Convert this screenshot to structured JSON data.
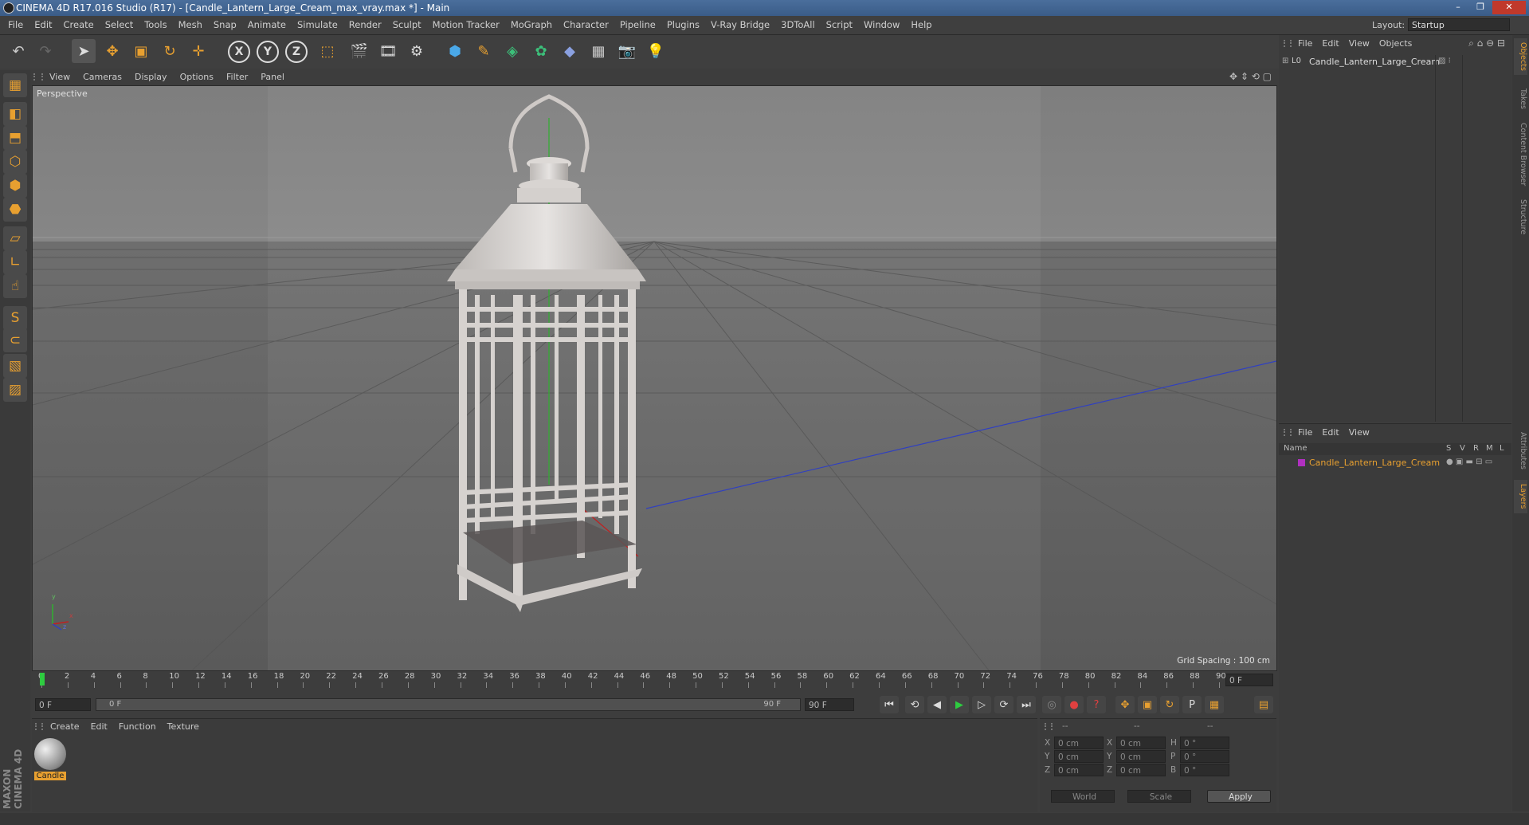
{
  "window": {
    "title": "CINEMA 4D R17.016 Studio (R17) - [Candle_Lantern_Large_Cream_max_vray.max *] - Main",
    "controls": [
      "–",
      "❐",
      "✕"
    ]
  },
  "menubar": {
    "items": [
      "File",
      "Edit",
      "Create",
      "Select",
      "Tools",
      "Mesh",
      "Snap",
      "Animate",
      "Simulate",
      "Render",
      "Sculpt",
      "Motion Tracker",
      "MoGraph",
      "Character",
      "Pipeline",
      "Plugins",
      "V-Ray Bridge",
      "3DToAll",
      "Script",
      "Window",
      "Help"
    ],
    "layout_label": "Layout:",
    "layout_value": "Startup"
  },
  "toolbar": {
    "undo_icon": "↶",
    "redo_icon": "↷",
    "select_icon": "➤",
    "move_icon": "✥",
    "scale_icon": "▣",
    "rotate_icon": "↻",
    "live_icon": "✛",
    "x_axis": "X",
    "y_axis": "Y",
    "z_axis": "Z",
    "coord_icon": "⬚",
    "render_view_icon": "🎬",
    "render_icon": "🎞",
    "render_settings_icon": "⚙",
    "cube_icon": "⬢",
    "pen_icon": "✎",
    "nurbs_icon": "◈",
    "array_icon": "✿",
    "deformer_icon": "◆",
    "scene_icon": "▦",
    "camera_icon": "📷",
    "light_icon": "💡"
  },
  "left_tools": {
    "icons": [
      "▦",
      "◧",
      "⬒",
      "⬡",
      "⬢",
      "⬣",
      "▱",
      "∟",
      "☝",
      "S",
      "⊂",
      "▧",
      "▨"
    ]
  },
  "viewport": {
    "menu": [
      "View",
      "Cameras",
      "Display",
      "Options",
      "Filter",
      "Panel"
    ],
    "label": "Perspective",
    "grid_spacing": "Grid Spacing : 100 cm",
    "nav_icons": "✥ ⇕ ⟲ ▢",
    "axis_x": "x",
    "axis_y": "y",
    "axis_z": "z"
  },
  "timeline": {
    "ticks": [
      "0",
      "2",
      "4",
      "6",
      "8",
      "10",
      "12",
      "14",
      "16",
      "18",
      "20",
      "22",
      "24",
      "26",
      "28",
      "30",
      "32",
      "34",
      "36",
      "38",
      "40",
      "42",
      "44",
      "46",
      "48",
      "50",
      "52",
      "54",
      "56",
      "58",
      "60",
      "62",
      "64",
      "66",
      "68",
      "70",
      "72",
      "74",
      "76",
      "78",
      "80",
      "82",
      "84",
      "86",
      "88",
      "90"
    ],
    "current_frame": "0 F"
  },
  "anim": {
    "start": "0 F",
    "range_start": "0 F",
    "range_end": "90 F",
    "end": "90 F",
    "buttons": [
      "⏮",
      "⟲",
      "◀",
      "▶",
      "▷",
      "⟳",
      "⏭"
    ]
  },
  "materials": {
    "menu": [
      "Create",
      "Edit",
      "Function",
      "Texture"
    ],
    "items": [
      {
        "name": "Candle"
      }
    ]
  },
  "coords": {
    "header": [
      "--",
      "--",
      "--"
    ],
    "rows": [
      {
        "a": "X",
        "av": "0 cm",
        "b": "X",
        "bv": "0 cm",
        "c": "H",
        "cv": "0 °"
      },
      {
        "a": "Y",
        "av": "0 cm",
        "b": "Y",
        "bv": "0 cm",
        "c": "P",
        "cv": "0 °"
      },
      {
        "a": "Z",
        "av": "0 cm",
        "b": "Z",
        "bv": "0 cm",
        "c": "B",
        "cv": "0 °"
      }
    ],
    "world": "World",
    "scale": "Scale",
    "apply": "Apply"
  },
  "objects": {
    "menu": [
      "File",
      "Edit",
      "View",
      "Objects"
    ],
    "items": [
      {
        "name": "Candle_Lantern_Large_Cream"
      }
    ]
  },
  "layers": {
    "menu": [
      "File",
      "Edit",
      "View"
    ],
    "cols": [
      "Name",
      "S",
      "V",
      "R",
      "M",
      "L"
    ],
    "items": [
      {
        "name": "Candle_Lantern_Large_Cream",
        "color": "#b030c0"
      }
    ]
  },
  "right_tabs": [
    "Objects",
    "Takes",
    "Content Browser",
    "Structure",
    "Attributes",
    "Layers"
  ],
  "brand": "MAXON CINEMA 4D",
  "colors": {
    "accent": "#e8a030",
    "layer_text": "#e8a030",
    "timeline_marker": "#2ecc40"
  }
}
